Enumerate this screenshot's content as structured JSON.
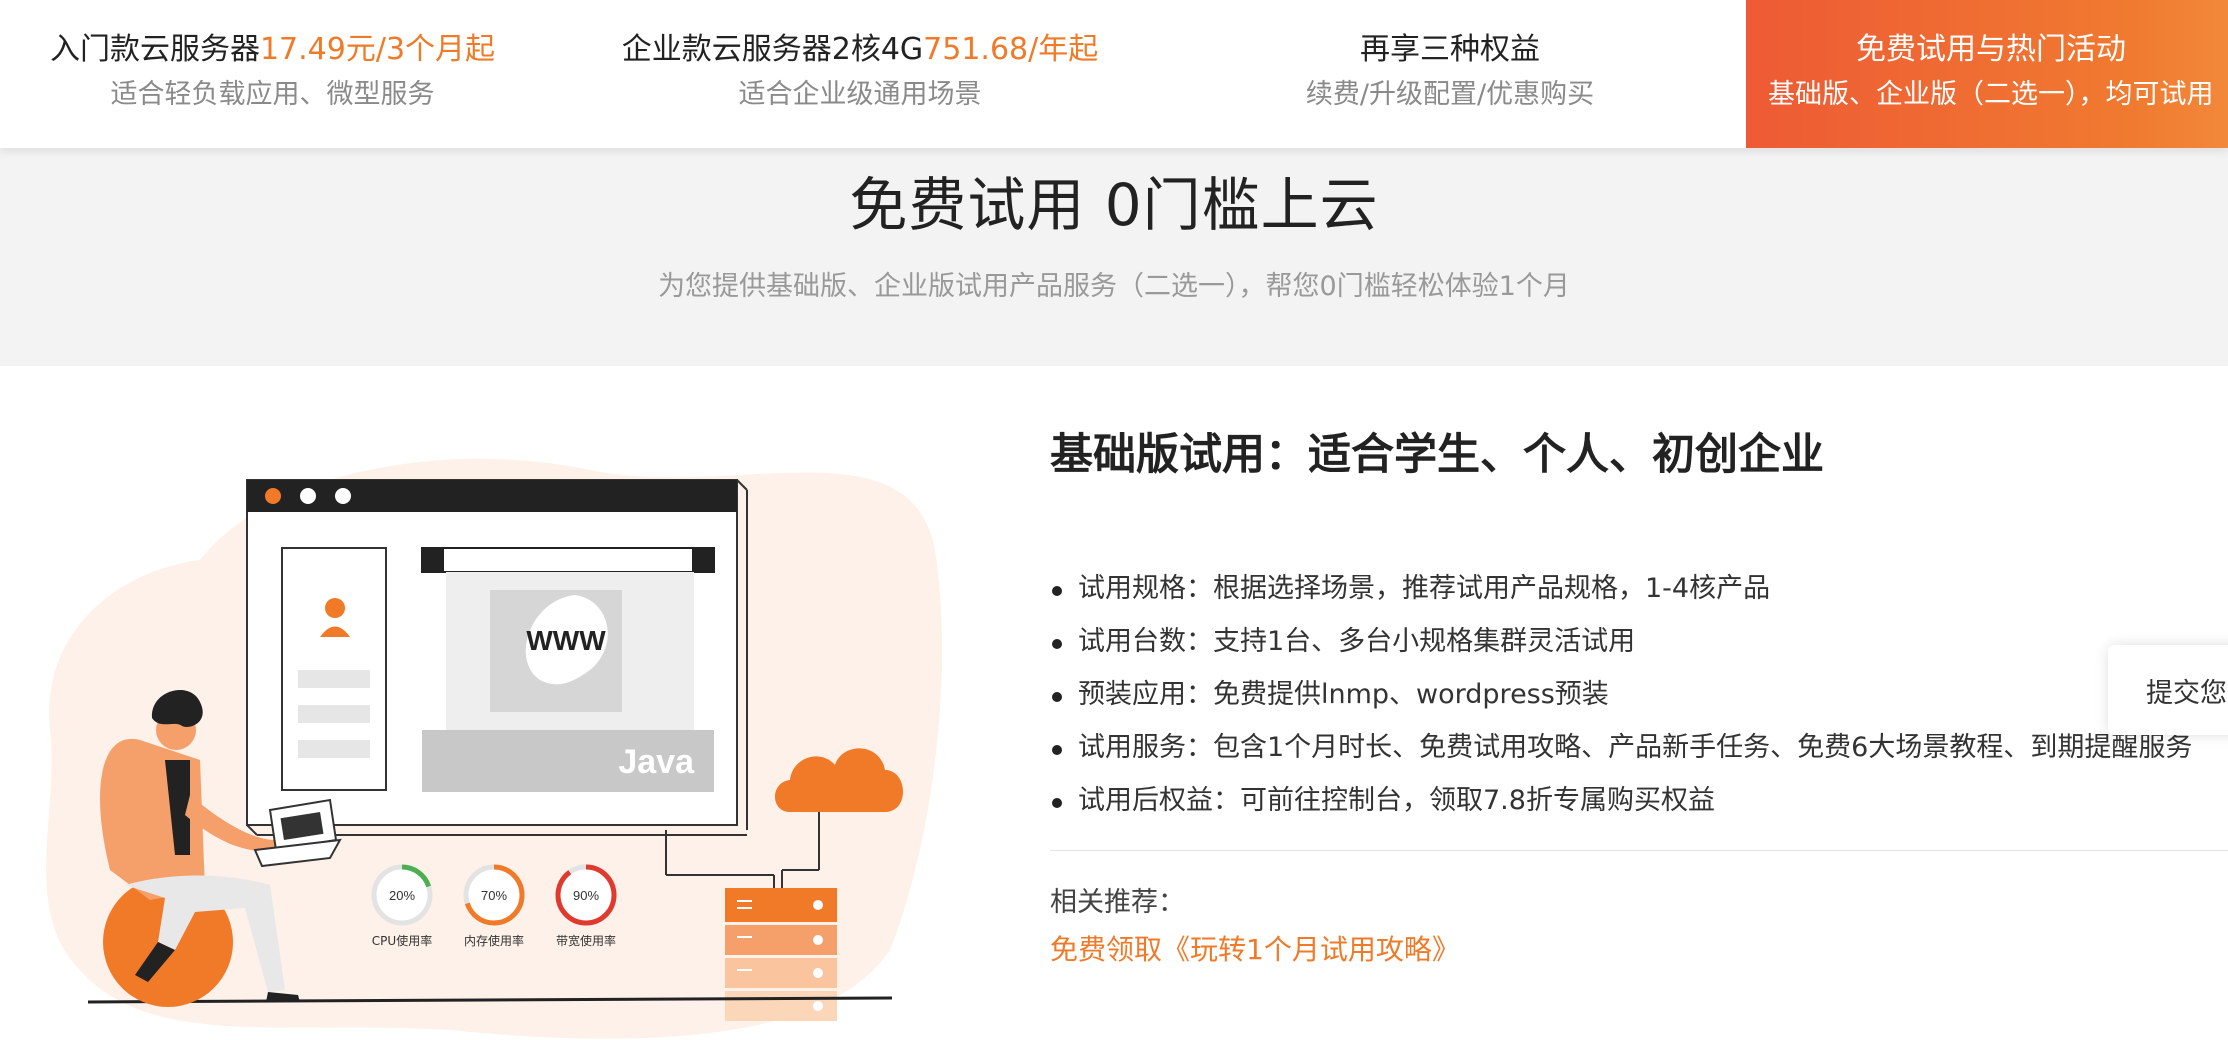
{
  "tabs": [
    {
      "title": "入门款云服务器",
      "highlight": "17.49元/3个月起",
      "subtitle": "适合轻负载应用、微型服务"
    },
    {
      "title": "企业款云服务器2核4G",
      "highlight": "751.68/年起",
      "subtitle": "适合企业级通用场景"
    },
    {
      "title": "再享三种权益",
      "highlight": "",
      "subtitle": "续费/升级配置/优惠购买"
    },
    {
      "title": "免费试用与热门活动",
      "highlight": "",
      "subtitle": "基础版、企业版（二选一），均可试用"
    }
  ],
  "hero": {
    "title": "免费试用 0门槛上云",
    "subtitle": "为您提供基础版、企业版试用产品服务（二选一），帮您0门槛轻松体验1个月"
  },
  "section": {
    "title": "基础版试用：适合学生、个人、初创企业",
    "features": [
      "试用规格：根据选择场景，推荐试用产品规格，1-4核产品",
      "试用台数：支持1台、多台小规格集群灵活试用",
      "预装应用：免费提供lnmp、wordpress预装",
      "试用服务：包含1个月时长、免费试用攻略、产品新手任务、免费6大场景教程、到期提醒服务",
      "试用后权益：可前往控制台，领取7.8折专属购买权益"
    ],
    "related_label": "相关推荐：",
    "related_link": "免费领取《玩转1个月试用攻略》"
  },
  "illustration": {
    "www": "WWW",
    "java": "Java",
    "gauges": [
      {
        "value": "20%",
        "label": "CPU使用率",
        "fraction": 0.2,
        "color": "#4caf50"
      },
      {
        "value": "70%",
        "label": "内存使用率",
        "fraction": 0.7,
        "color": "#f07a28"
      },
      {
        "value": "90%",
        "label": "带宽使用率",
        "fraction": 0.9,
        "color": "#e03a2e"
      }
    ]
  },
  "float_button": {
    "label": "提交您"
  },
  "colors": {
    "accent": "#f07a28",
    "active_tab_start": "#ee5a35",
    "active_tab_end": "#f2883a"
  }
}
